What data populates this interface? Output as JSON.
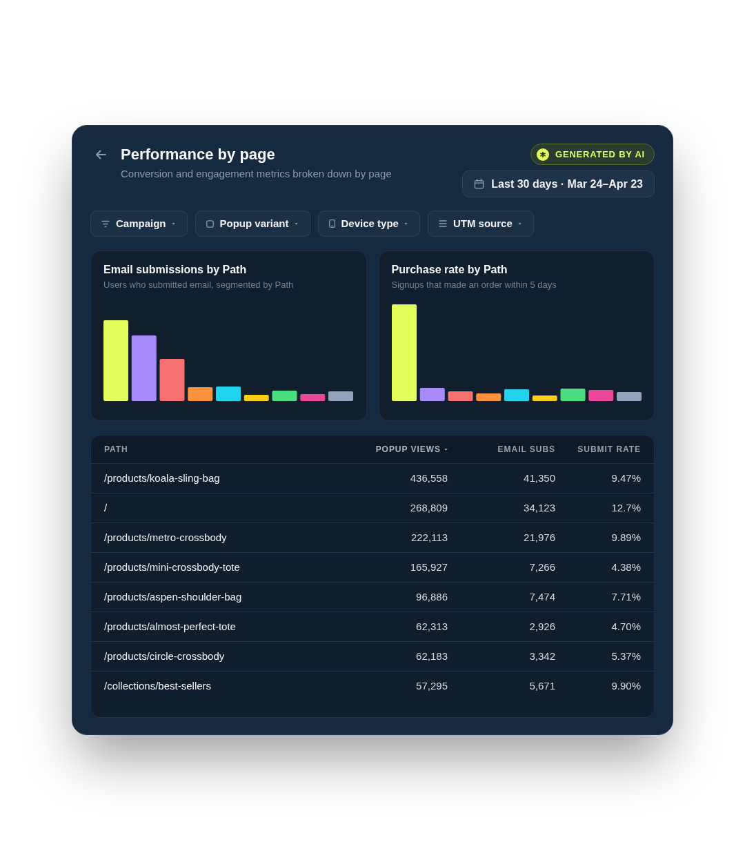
{
  "header": {
    "title": "Performance by page",
    "subtitle": "Conversion and engagement metrics broken down by page"
  },
  "badge": {
    "label": "GENERATED BY AI"
  },
  "date_range": {
    "label": "Last 30 days · Mar 24–Apr 23"
  },
  "filters": [
    {
      "label": "Campaign"
    },
    {
      "label": "Popup variant"
    },
    {
      "label": "Device type"
    },
    {
      "label": "UTM source"
    }
  ],
  "charts": [
    {
      "title": "Email submissions by Path",
      "subtitle": "Users who submitted email, segmented by Path"
    },
    {
      "title": "Purchase rate by Path",
      "subtitle": "Signups that made an order within 5 days"
    }
  ],
  "table": {
    "columns": [
      {
        "label": "PATH",
        "sorted": false
      },
      {
        "label": "POPUP VIEWS",
        "sorted": true
      },
      {
        "label": "EMAIL SUBS",
        "sorted": false
      },
      {
        "label": "SUBMIT RATE",
        "sorted": false
      }
    ],
    "rows": [
      {
        "path": "/products/koala-sling-bag",
        "popup_views": "436,558",
        "email_subs": "41,350",
        "submit_rate": "9.47%"
      },
      {
        "path": "/",
        "popup_views": "268,809",
        "email_subs": "34,123",
        "submit_rate": "12.7%"
      },
      {
        "path": "/products/metro-crossbody",
        "popup_views": "222,113",
        "email_subs": "21,976",
        "submit_rate": "9.89%"
      },
      {
        "path": "/products/mini-crossbody-tote",
        "popup_views": "165,927",
        "email_subs": "7,266",
        "submit_rate": "4.38%"
      },
      {
        "path": "/products/aspen-shoulder-bag",
        "popup_views": "96,886",
        "email_subs": "7,474",
        "submit_rate": "7.71%"
      },
      {
        "path": "/products/almost-perfect-tote",
        "popup_views": "62,313",
        "email_subs": "2,926",
        "submit_rate": "4.70%"
      },
      {
        "path": "/products/circle-crossbody",
        "popup_views": "62,183",
        "email_subs": "3,342",
        "submit_rate": "5.37%"
      },
      {
        "path": "/collections/best-sellers",
        "popup_views": "57,295",
        "email_subs": "5,671",
        "submit_rate": "9.90%"
      }
    ]
  }
}
